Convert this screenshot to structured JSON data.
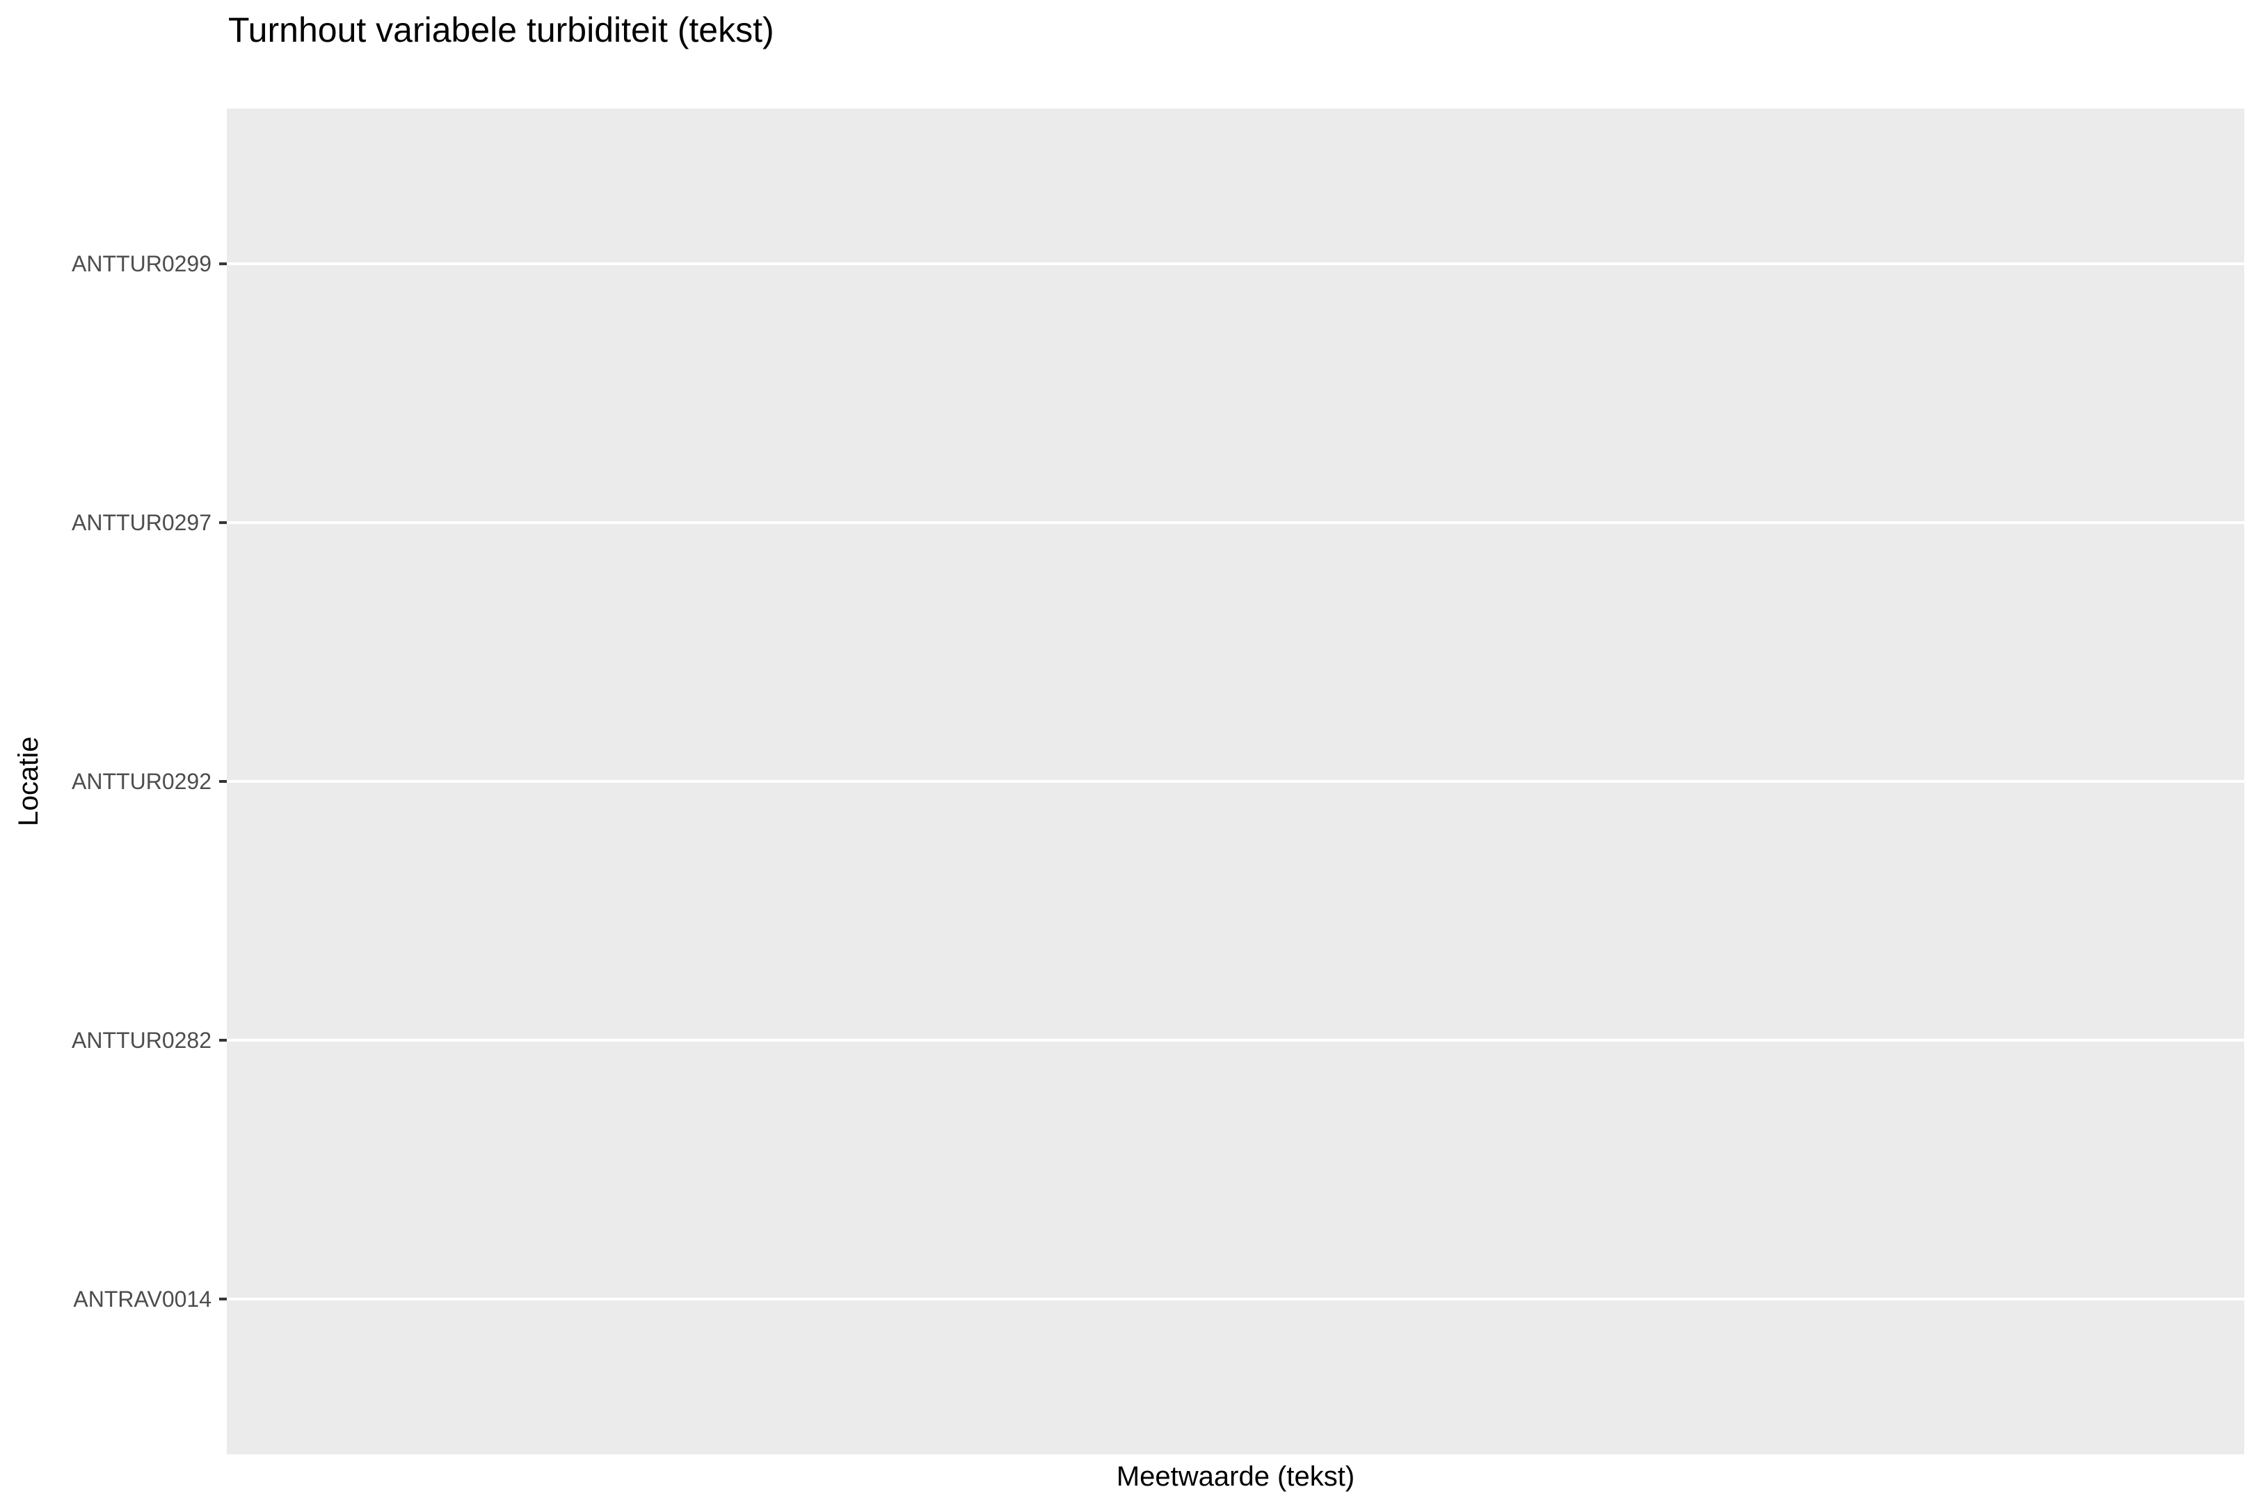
{
  "chart_data": {
    "type": "scatter",
    "title": "Turnhout variabele turbiditeit (tekst)",
    "xlabel": "Meetwaarde (tekst)",
    "ylabel": "Locatie",
    "categories": [
      "ANTTUR0299",
      "ANTTUR0297",
      "ANTTUR0292",
      "ANTTUR0282",
      "ANTRAV0014"
    ],
    "series": [],
    "grid": true,
    "panel_background": "#ebebeb",
    "gridline_color": "#ffffff",
    "tick_color": "#333333",
    "tick_label_color": "#4d4d4d"
  }
}
